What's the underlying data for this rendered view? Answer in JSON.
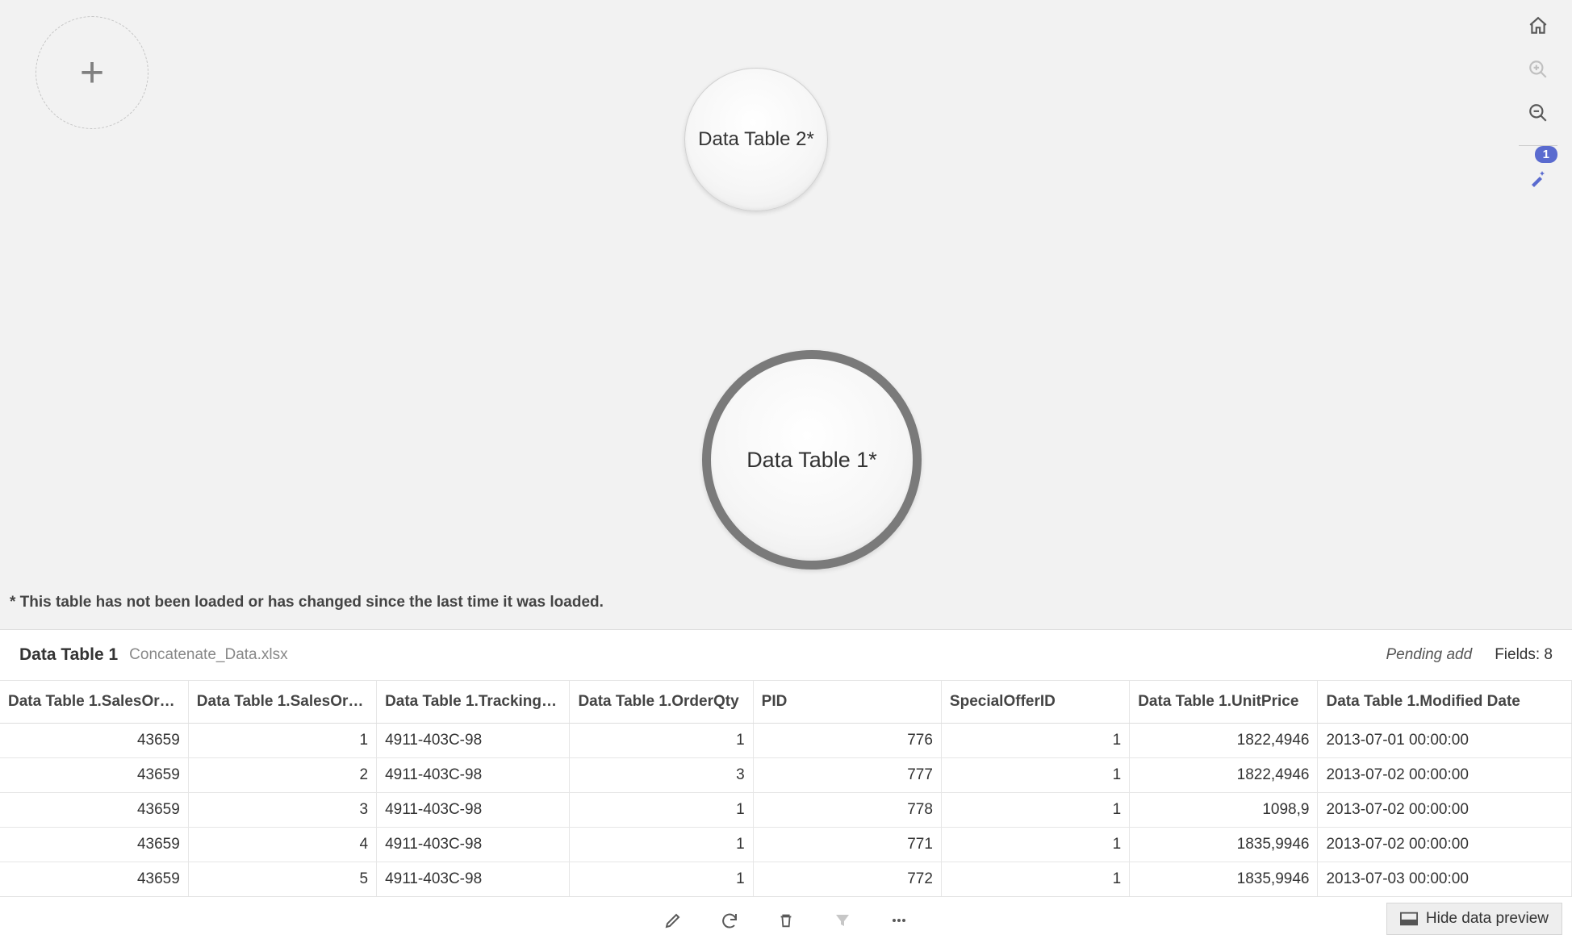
{
  "canvas": {
    "node_small_label": "Data Table 2*",
    "node_large_label": "Data Table 1*",
    "footnote": "* This table has not been loaded or has changed since the last time it was loaded.",
    "magic_badge": "1"
  },
  "preview": {
    "title": "Data Table 1",
    "file": "Concatenate_Data.xlsx",
    "status": "Pending add",
    "fields_label": "Fields: 8",
    "columns": [
      "Data Table 1.SalesOr…",
      "Data Table 1.SalesOr…",
      "Data Table 1.Tracking…",
      "Data Table 1.OrderQty",
      "PID",
      "SpecialOfferID",
      "Data Table 1.UnitPrice",
      "Data Table 1.Modified Date"
    ],
    "rows": [
      [
        "43659",
        "1",
        "4911-403C-98",
        "1",
        "776",
        "1",
        "1822,4946",
        "2013-07-01 00:00:00"
      ],
      [
        "43659",
        "2",
        "4911-403C-98",
        "3",
        "777",
        "1",
        "1822,4946",
        "2013-07-02 00:00:00"
      ],
      [
        "43659",
        "3",
        "4911-403C-98",
        "1",
        "778",
        "1",
        "1098,9",
        "2013-07-02 00:00:00"
      ],
      [
        "43659",
        "4",
        "4911-403C-98",
        "1",
        "771",
        "1",
        "1835,9946",
        "2013-07-02 00:00:00"
      ],
      [
        "43659",
        "5",
        "4911-403C-98",
        "1",
        "772",
        "1",
        "1835,9946",
        "2013-07-03 00:00:00"
      ]
    ],
    "numeric_cols": [
      0,
      1,
      3,
      4,
      5,
      6
    ]
  },
  "bottombar": {
    "hide_label": "Hide data preview"
  }
}
